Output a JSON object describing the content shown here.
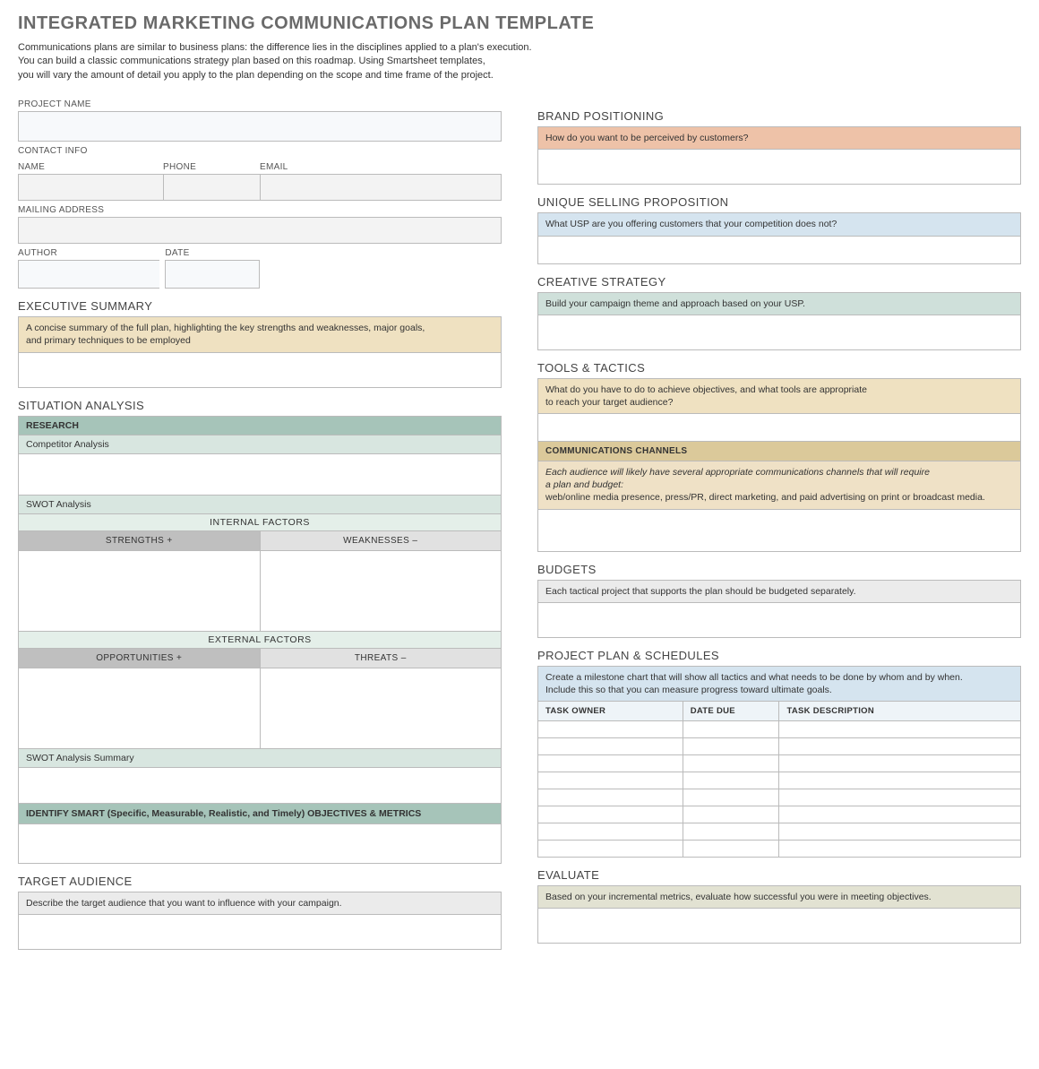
{
  "title": "INTEGRATED MARKETING COMMUNICATIONS PLAN TEMPLATE",
  "intro": {
    "l1": "Communications plans are similar to business plans: the difference lies in the disciplines applied to a plan's execution.",
    "l2": "You can build a classic communications strategy plan based on this roadmap. Using Smartsheet templates,",
    "l3": "you will vary the amount of detail you apply to the plan depending on the scope and time frame of the project."
  },
  "left": {
    "project_name_label": "PROJECT NAME",
    "contact_info_label": "CONTACT INFO",
    "name_label": "NAME",
    "phone_label": "PHONE",
    "email_label": "EMAIL",
    "mailing_label": "MAILING ADDRESS",
    "author_label": "AUTHOR",
    "date_label": "DATE",
    "exec_title": "EXECUTIVE SUMMARY",
    "exec_hint_l1": "A concise summary of the full plan, highlighting the key strengths and weaknesses, major goals,",
    "exec_hint_l2": "and primary techniques to be employed",
    "sa_title": "SITUATION ANALYSIS",
    "sa_research": "RESEARCH",
    "sa_comp": "Competitor Analysis",
    "sa_swot": "SWOT Analysis",
    "sa_internal": "INTERNAL FACTORS",
    "sa_strengths": "STRENGTHS  +",
    "sa_weaknesses": "WEAKNESSES  –",
    "sa_external": "EXTERNAL FACTORS",
    "sa_opps": "OPPORTUNITIES  +",
    "sa_threats": "THREATS  –",
    "sa_summary": "SWOT Analysis Summary",
    "sa_obj": "IDENTIFY SMART (Specific, Measurable, Realistic, and Timely) OBJECTIVES & METRICS",
    "ta_title": "TARGET AUDIENCE",
    "ta_hint": "Describe the target audience that you want to influence with your campaign."
  },
  "right": {
    "bp_title": "BRAND POSITIONING",
    "bp_hint": "How do you want to be perceived by customers?",
    "usp_title": "UNIQUE SELLING PROPOSITION",
    "usp_hint": "What USP are you offering customers that your competition does not?",
    "cs_title": "CREATIVE STRATEGY",
    "cs_hint": "Build your campaign theme and approach based on your USP.",
    "tt_title": "TOOLS & TACTICS",
    "tt_hint_l1": "What do you have to do to achieve objectives, and what tools are appropriate",
    "tt_hint_l2": "to reach your target audience?",
    "cc_head": "COMMUNICATIONS CHANNELS",
    "cc_hint_l1": "Each audience will likely have several appropriate communications channels that will require",
    "cc_hint_l2": "a plan and budget:",
    "cc_hint_l3": "web/online media presence, press/PR, direct marketing, and paid advertising on print or broadcast media.",
    "bud_title": "BUDGETS",
    "bud_hint": "Each tactical project that supports the plan should be budgeted separately.",
    "pp_title": "PROJECT PLAN & SCHEDULES",
    "pp_hint_l1": "Create a milestone chart that will show all tactics and what needs to be done by whom and by when.",
    "pp_hint_l2": "Include this so that you can measure progress toward ultimate goals.",
    "pp_col1": "TASK OWNER",
    "pp_col2": "DATE DUE",
    "pp_col3": "TASK DESCRIPTION",
    "pp_rows": 8,
    "ev_title": "EVALUATE",
    "ev_hint": "Based on your incremental metrics, evaluate how successful you were in meeting objectives."
  }
}
